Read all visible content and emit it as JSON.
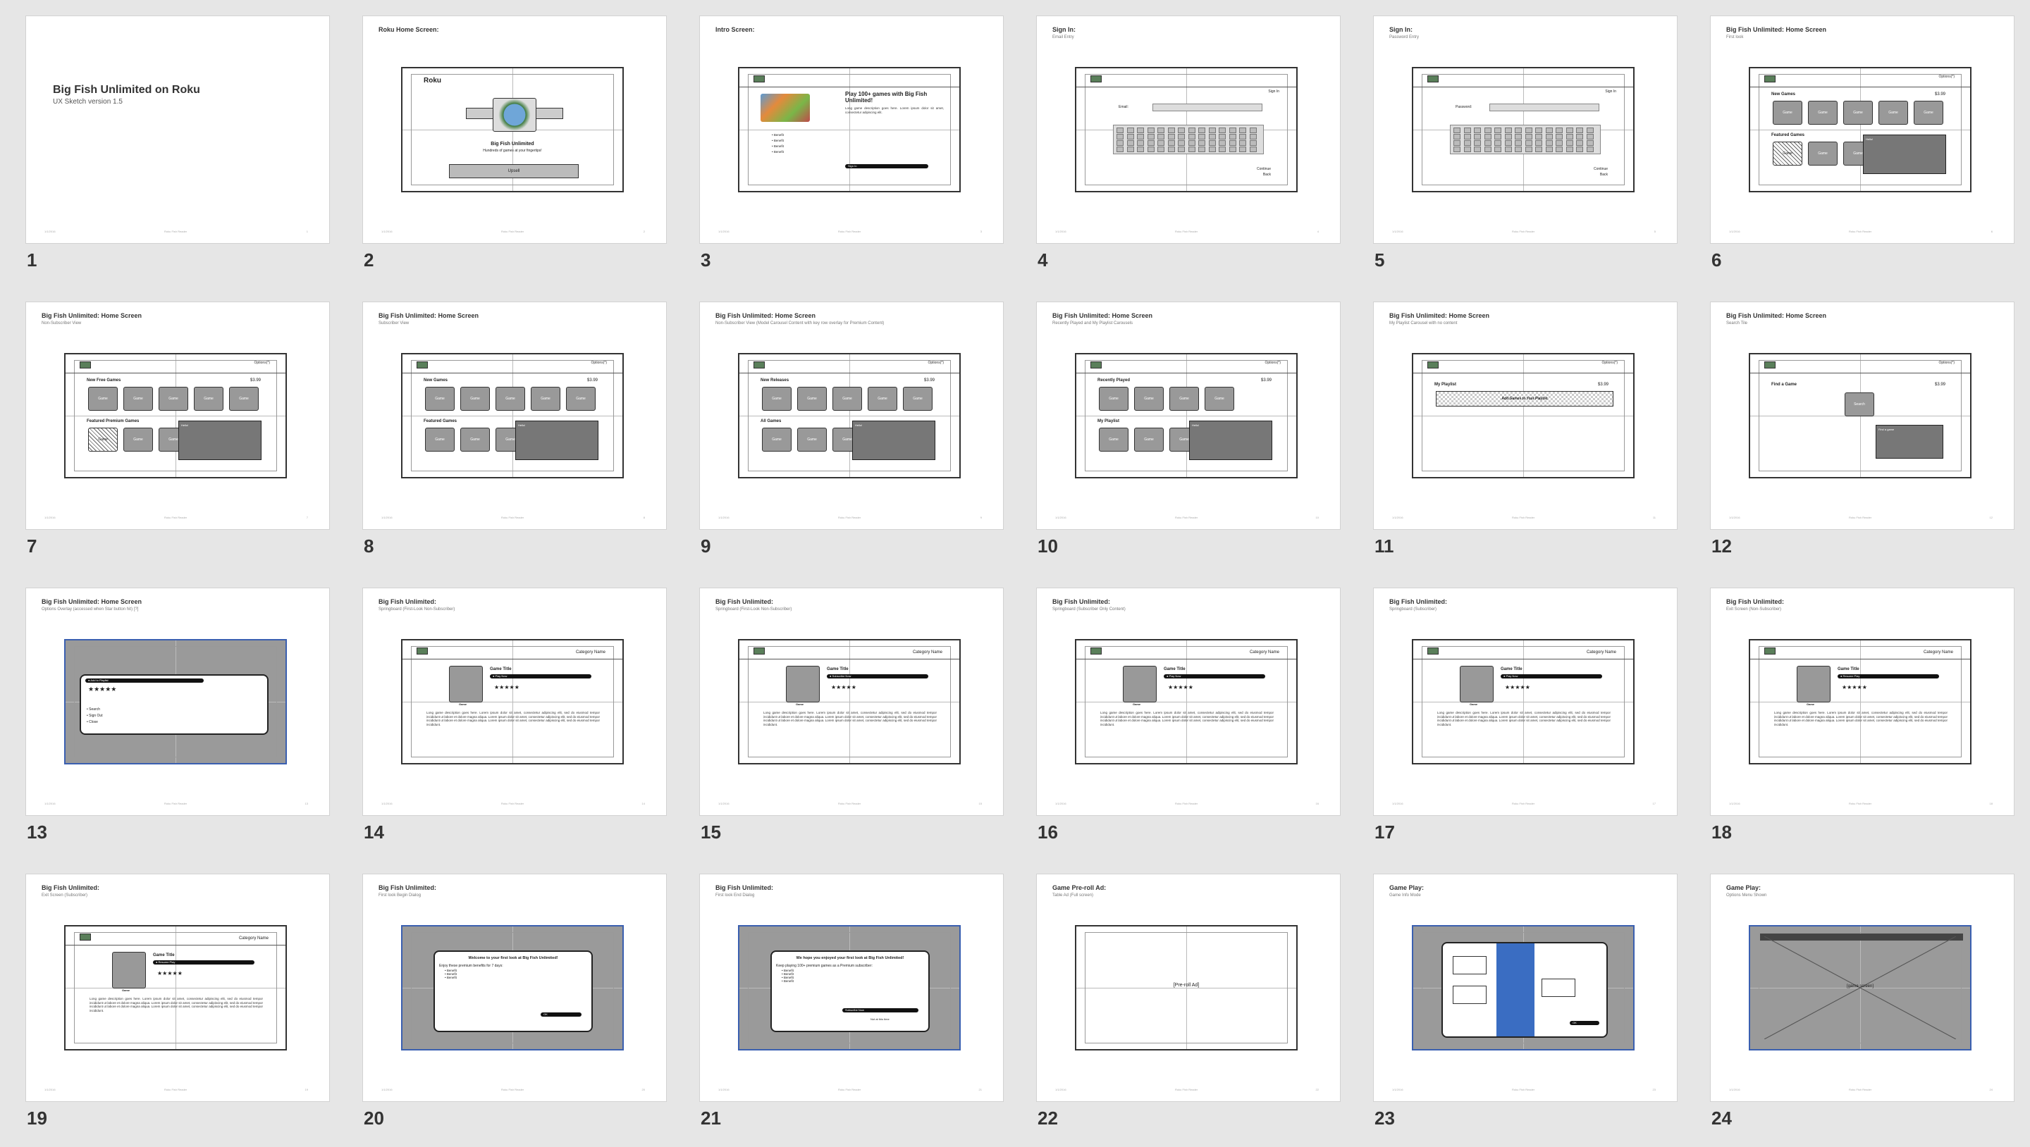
{
  "app": {
    "title": "Big Fish Unlimited on Roku — UX Sketch"
  },
  "colors": {
    "background": "#e6e6e6",
    "slide": "#ffffff",
    "selection": "#3b7ddd",
    "tile": "#999999"
  },
  "slides": [
    {
      "num": "1",
      "title": "Big Fish Unlimited on Roku",
      "subtitle": "UX Sketch version 1.5"
    },
    {
      "num": "2",
      "title": "Roku Home Screen:",
      "subtitle": "",
      "brand": "Roku",
      "app_name": "Big Fish Unlimited",
      "tagline": "Hundreds of games at your fingertips!",
      "button": "Upsell"
    },
    {
      "num": "3",
      "title": "Intro Screen:",
      "subtitle": "",
      "headline": "Play 100+ games with Big Fish Unlimited!",
      "body": "Long game description goes here. Lorem ipsum dolor sit amet, consectetur adipiscing elit.",
      "benefits": [
        "Benefit",
        "Benefit",
        "Benefit",
        "Benefit"
      ],
      "button": "Sign In"
    },
    {
      "num": "4",
      "title": "Sign In:",
      "subtitle": "Email Entry",
      "field_label": "Email",
      "corner": "Sign In",
      "continue": "Continue",
      "back": "Back"
    },
    {
      "num": "5",
      "title": "Sign In:",
      "subtitle": "Password Entry",
      "field_label": "Password",
      "corner": "Sign In",
      "continue": "Continue",
      "back": "Back"
    },
    {
      "num": "6",
      "title": "Big Fish Unlimited: Home Screen",
      "subtitle": "First look",
      "row1": "New Games",
      "row2": "Featured Games",
      "price": "$3.99",
      "tile": "Game",
      "popover": "Hello!"
    },
    {
      "num": "7",
      "title": "Big Fish Unlimited: Home Screen",
      "subtitle": "Non-Subscriber View",
      "row1": "New Free Games",
      "row2": "Featured Premium Games",
      "price": "$3.99",
      "tile": "Game",
      "popover": "Hello!"
    },
    {
      "num": "8",
      "title": "Big Fish Unlimited: Home Screen",
      "subtitle": "Subscriber View",
      "row1": "New Games",
      "row2": "Featured Games",
      "price": "$3.99",
      "tile": "Game",
      "popover": "Hello!"
    },
    {
      "num": "9",
      "title": "Big Fish Unlimited: Home Screen",
      "subtitle": "Non-Subscriber View (Model Carousel Content with key row overlay for Premium Content)",
      "row1": "New Releases",
      "row2": "All Games",
      "price": "$3.99",
      "tile": "Game",
      "popover": "Hello!"
    },
    {
      "num": "10",
      "title": "Big Fish Unlimited: Home Screen",
      "subtitle": "Recently Played and My Playlist Carousels",
      "row1": "Recently Played",
      "row2": "My Playlist",
      "price": "$3.99",
      "tile": "Game",
      "popover": "Hello!"
    },
    {
      "num": "11",
      "title": "Big Fish Unlimited: Home Screen",
      "subtitle": "My Playlist Carousel with no content",
      "row1": "My Playlist",
      "banner": "Add Games to Your Playlist",
      "price": "$3.99"
    },
    {
      "num": "12",
      "title": "Big Fish Unlimited: Home Screen",
      "subtitle": "Search Tile",
      "row1": "Find a Game",
      "price": "$3.99",
      "tile": "Search",
      "popover": "Find a game"
    },
    {
      "num": "13",
      "title": "Big Fish Unlimited: Home Screen",
      "subtitle": "Options Overlay (accessed when Star button hit) [?]",
      "menu": [
        "Add to Playlist",
        "Search",
        "Sign Out",
        "Close"
      ],
      "rating": "★★★★★"
    },
    {
      "num": "14",
      "title": "Big Fish Unlimited:",
      "subtitle": "Springboard (First-Look Non-Subscriber)",
      "game_title": "Game Title",
      "category": "Category Name",
      "action": "Play Now",
      "thumb": "Game"
    },
    {
      "num": "15",
      "title": "Big Fish Unlimited:",
      "subtitle": "Springboard (First-Look Non-Subscriber)",
      "game_title": "Game Title",
      "category": "Category Name",
      "action": "Subscribe Now",
      "thumb": "Game"
    },
    {
      "num": "16",
      "title": "Big Fish Unlimited:",
      "subtitle": "Springboard (Subscriber Only Content)",
      "game_title": "Game Title",
      "category": "Category Name",
      "action": "Play Now",
      "thumb": "Game"
    },
    {
      "num": "17",
      "title": "Big Fish Unlimited:",
      "subtitle": "Springboard (Subscriber)",
      "game_title": "Game Title",
      "category": "Category Name",
      "action": "Play Now",
      "thumb": "Game"
    },
    {
      "num": "18",
      "title": "Big Fish Unlimited:",
      "subtitle": "Exit Screen (Non-Subscriber)",
      "game_title": "Game Title",
      "category": "Category Name",
      "action": "Resume Play",
      "thumb": "Game"
    },
    {
      "num": "19",
      "title": "Big Fish Unlimited:",
      "subtitle": "Exit Screen (Subscriber)",
      "game_title": "Game Title",
      "category": "Category Name",
      "action": "Resume Play",
      "thumb": "Game"
    },
    {
      "num": "20",
      "title": "Big Fish Unlimited:",
      "subtitle": "First look Begin Dialog",
      "dialog_title": "Welcome to your first look at Big Fish Unlimited!",
      "dialog_body": "Enjoy these premium benefits for 7 days:",
      "benefits": [
        "Benefit",
        "Benefit",
        "Benefit"
      ],
      "button": "OK"
    },
    {
      "num": "21",
      "title": "Big Fish Unlimited:",
      "subtitle": "First look End Dialog",
      "dialog_title": "We hope you enjoyed your first look at Big Fish Unlimited!",
      "dialog_body": "Keep playing 100+ premium games as a Premium subscriber:",
      "benefits": [
        "Benefit",
        "Benefit",
        "Benefit",
        "Benefit"
      ],
      "button": "Subscribe Now",
      "secondary": "Not at this time"
    },
    {
      "num": "22",
      "title": "Game Pre-roll Ad:",
      "subtitle": "Table Ad (Full screen)",
      "placeholder": "[Pre-roll Ad]"
    },
    {
      "num": "23",
      "title": "Game Play:",
      "subtitle": "Game Info Mode",
      "button": "OK"
    },
    {
      "num": "24",
      "title": "Game Play:",
      "subtitle": "Options Menu Shown",
      "placeholder": "[game screen]"
    }
  ],
  "footer": {
    "left": "1/1/2016",
    "center": "Roku Fish Reader",
    "right": "1"
  }
}
